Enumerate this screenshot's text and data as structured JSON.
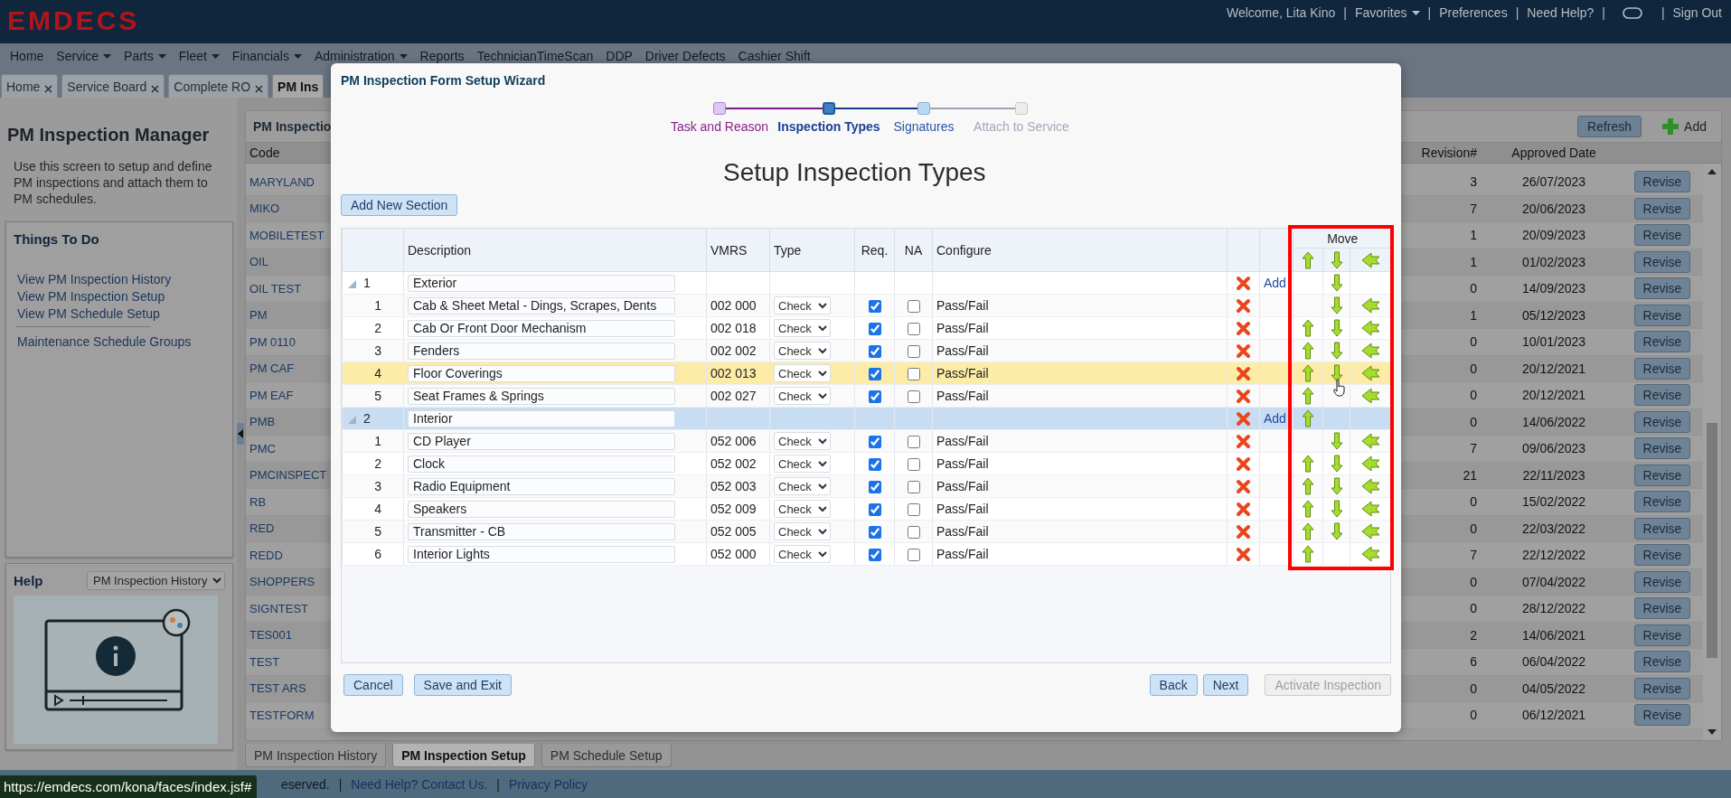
{
  "header": {
    "logo": "EMDECS",
    "items": [
      {
        "kind": "text",
        "label": "Welcome, Lita Kino"
      },
      {
        "kind": "sep",
        "label": "|"
      },
      {
        "kind": "menu",
        "label": "Favorites"
      },
      {
        "kind": "sep",
        "label": "|"
      },
      {
        "kind": "link",
        "label": "Preferences"
      },
      {
        "kind": "sep",
        "label": "|"
      },
      {
        "kind": "link",
        "label": "Need Help?"
      },
      {
        "kind": "sep",
        "label": "|"
      },
      {
        "kind": "chat"
      },
      {
        "kind": "sep",
        "label": "|"
      },
      {
        "kind": "link",
        "label": "Sign Out"
      }
    ]
  },
  "nav": [
    {
      "label": "Home",
      "dropdown": false
    },
    {
      "label": "Service",
      "dropdown": true
    },
    {
      "label": "Parts",
      "dropdown": true
    },
    {
      "label": "Fleet",
      "dropdown": true
    },
    {
      "label": "Financials",
      "dropdown": true
    },
    {
      "label": "Administration",
      "dropdown": true
    },
    {
      "label": "Reports",
      "dropdown": false
    },
    {
      "label": "TechnicianTimeScan",
      "dropdown": false
    },
    {
      "label": "DDP",
      "dropdown": false
    },
    {
      "label": "Driver Defects",
      "dropdown": false
    },
    {
      "label": "Cashier Shift",
      "dropdown": false
    }
  ],
  "tabs": [
    {
      "label": "Home",
      "selected": false
    },
    {
      "label": "Service Board",
      "selected": false
    },
    {
      "label": "Complete RO",
      "selected": false
    },
    {
      "label": "PM Ins",
      "selected": true
    }
  ],
  "sidebar": {
    "title": "PM Inspection Manager",
    "description": "Use this screen to setup and define PM inspections and attach them to PM schedules.",
    "todo_title": "Things To Do",
    "links": [
      "View PM Inspection History",
      "View PM Inspection Setup",
      "View PM Schedule Setup"
    ],
    "extra_links": [
      "Maintenance Schedule Groups"
    ],
    "help_title": "Help",
    "help_select": "PM Inspection History"
  },
  "list_panel": {
    "title": "PM Inspectio",
    "refresh": "Refresh",
    "add": "Add",
    "columns": [
      "Code",
      "Revision#",
      "Approved Date"
    ],
    "rows": [
      {
        "code": "MARYLAND",
        "revision": "3",
        "date": "26/07/2023",
        "action": "Revise"
      },
      {
        "code": "MIKO",
        "revision": "7",
        "date": "20/06/2023",
        "action": "Revise"
      },
      {
        "code": "MOBILETEST",
        "revision": "1",
        "date": "20/09/2023",
        "action": "Revise"
      },
      {
        "code": "OIL",
        "revision": "1",
        "date": "01/02/2023",
        "action": "Revise"
      },
      {
        "code": "OIL TEST",
        "revision": "0",
        "date": "14/09/2023",
        "action": "Revise"
      },
      {
        "code": "PM",
        "revision": "1",
        "date": "05/12/2023",
        "action": "Revise"
      },
      {
        "code": "PM 0110",
        "revision": "0",
        "date": "10/01/2023",
        "action": "Revise"
      },
      {
        "code": "PM CAF",
        "revision": "0",
        "date": "20/12/2021",
        "action": "Revise"
      },
      {
        "code": "PM EAF",
        "revision": "0",
        "date": "20/12/2021",
        "action": "Revise"
      },
      {
        "code": "PMB",
        "revision": "0",
        "date": "14/06/2022",
        "action": "Revise"
      },
      {
        "code": "PMC",
        "revision": "7",
        "date": "09/06/2023",
        "action": "Revise"
      },
      {
        "code": "PMCINSPECT",
        "revision": "21",
        "date": "22/11/2023",
        "action": "Revise"
      },
      {
        "code": "RB",
        "revision": "0",
        "date": "15/02/2022",
        "action": "Revise"
      },
      {
        "code": "RED",
        "revision": "0",
        "date": "22/03/2022",
        "action": "Revise"
      },
      {
        "code": "REDD",
        "revision": "7",
        "date": "22/12/2022",
        "action": "Revise"
      },
      {
        "code": "SHOPPERS",
        "revision": "0",
        "date": "07/04/2022",
        "action": "Revise"
      },
      {
        "code": "SIGNTEST",
        "revision": "0",
        "date": "28/12/2022",
        "action": "Revise"
      },
      {
        "code": "TES001",
        "revision": "2",
        "date": "14/06/2021",
        "action": "Revise"
      },
      {
        "code": "TEST",
        "revision": "6",
        "date": "06/04/2022",
        "action": "Revise"
      },
      {
        "code": "TEST ARS",
        "revision": "0",
        "date": "04/05/2022",
        "action": "Revise"
      },
      {
        "code": "TESTFORM",
        "revision": "0",
        "date": "06/12/2021",
        "action": "Revise"
      }
    ]
  },
  "bottom_tabs": [
    {
      "label": "PM Inspection History",
      "selected": false
    },
    {
      "label": "PM Inspection Setup",
      "selected": true
    },
    {
      "label": "PM Schedule Setup",
      "selected": false
    }
  ],
  "footer": {
    "items": [
      {
        "kind": "text",
        "label": "eserved."
      },
      {
        "kind": "sep",
        "label": "|"
      },
      {
        "kind": "link",
        "label": "Need Help? Contact Us."
      },
      {
        "kind": "sep",
        "label": "|"
      },
      {
        "kind": "link",
        "label": "Privacy Policy"
      }
    ],
    "status_url": "https://emdecs.com/kona/faces/index.jsf#"
  },
  "modal": {
    "title": "PM Inspection Form Setup Wizard",
    "steps": [
      {
        "label": "Task and Reason",
        "visited": true,
        "selected": false,
        "enabled": true
      },
      {
        "label": "Inspection Types",
        "visited": false,
        "selected": true,
        "enabled": true
      },
      {
        "label": "Signatures",
        "visited": false,
        "selected": false,
        "enabled": true
      },
      {
        "label": "Attach to Service",
        "visited": false,
        "selected": false,
        "enabled": false
      }
    ],
    "heading": "Setup Inspection Types",
    "add_section": "Add New Section",
    "columns": [
      "Description",
      "VMRS",
      "Type",
      "Req.",
      "NA",
      "Configure"
    ],
    "move_header": "Move",
    "rows": [
      {
        "kind": "section",
        "number": "1",
        "description": "Exterior",
        "add": "Add",
        "up": false,
        "down": true,
        "copy": false,
        "selected": false,
        "hovered": false
      },
      {
        "kind": "item",
        "number": "1",
        "description": "Cab & Sheet Metal - Dings, Scrapes, Dents",
        "vmrs": "002 000",
        "type": "Check",
        "req": true,
        "na": false,
        "configure": "Pass/Fail",
        "up": false,
        "down": true,
        "copy": true,
        "selected": false,
        "hovered": false
      },
      {
        "kind": "item",
        "number": "2",
        "description": "Cab Or Front Door Mechanism",
        "vmrs": "002 018",
        "type": "Check",
        "req": true,
        "na": false,
        "configure": "Pass/Fail",
        "up": true,
        "down": true,
        "copy": true,
        "selected": false,
        "hovered": false
      },
      {
        "kind": "item",
        "number": "3",
        "description": "Fenders",
        "vmrs": "002 002",
        "type": "Check",
        "req": true,
        "na": false,
        "configure": "Pass/Fail",
        "up": true,
        "down": true,
        "copy": true,
        "selected": false,
        "hovered": false
      },
      {
        "kind": "item",
        "number": "4",
        "description": "Floor Coverings",
        "vmrs": "002 013",
        "type": "Check",
        "req": true,
        "na": false,
        "configure": "Pass/Fail",
        "up": true,
        "down": true,
        "copy": true,
        "selected": false,
        "hovered": true
      },
      {
        "kind": "item",
        "number": "5",
        "description": "Seat Frames & Springs",
        "vmrs": "002 027",
        "type": "Check",
        "req": true,
        "na": false,
        "configure": "Pass/Fail",
        "up": true,
        "down": false,
        "copy": true,
        "selected": false,
        "hovered": false
      },
      {
        "kind": "section",
        "number": "2",
        "description": "Interior",
        "add": "Add",
        "up": true,
        "down": false,
        "copy": false,
        "selected": true,
        "hovered": false
      },
      {
        "kind": "item",
        "number": "1",
        "description": "CD Player",
        "vmrs": "052 006",
        "type": "Check",
        "req": true,
        "na": false,
        "configure": "Pass/Fail",
        "up": false,
        "down": true,
        "copy": true,
        "selected": false,
        "hovered": false
      },
      {
        "kind": "item",
        "number": "2",
        "description": "Clock",
        "vmrs": "052 002",
        "type": "Check",
        "req": true,
        "na": false,
        "configure": "Pass/Fail",
        "up": true,
        "down": true,
        "copy": true,
        "selected": false,
        "hovered": false
      },
      {
        "kind": "item",
        "number": "3",
        "description": "Radio Equipment",
        "vmrs": "052 003",
        "type": "Check",
        "req": true,
        "na": false,
        "configure": "Pass/Fail",
        "up": true,
        "down": true,
        "copy": true,
        "selected": false,
        "hovered": false
      },
      {
        "kind": "item",
        "number": "4",
        "description": "Speakers",
        "vmrs": "052 009",
        "type": "Check",
        "req": true,
        "na": false,
        "configure": "Pass/Fail",
        "up": true,
        "down": true,
        "copy": true,
        "selected": false,
        "hovered": false
      },
      {
        "kind": "item",
        "number": "5",
        "description": "Transmitter - CB",
        "vmrs": "052 005",
        "type": "Check",
        "req": true,
        "na": false,
        "configure": "Pass/Fail",
        "up": true,
        "down": true,
        "copy": true,
        "selected": false,
        "hovered": false
      },
      {
        "kind": "item",
        "number": "6",
        "description": "Interior Lights",
        "vmrs": "052 000",
        "type": "Check",
        "req": true,
        "na": false,
        "configure": "Pass/Fail",
        "up": true,
        "down": false,
        "copy": true,
        "selected": false,
        "hovered": false
      }
    ],
    "left_buttons": [
      {
        "label": "Cancel",
        "disabled": false
      },
      {
        "label": "Save and Exit",
        "disabled": false
      }
    ],
    "right_buttons": [
      {
        "label": "Back",
        "disabled": false
      },
      {
        "label": "Next",
        "disabled": false
      },
      {
        "label": "Activate Inspection",
        "disabled": true
      }
    ]
  }
}
